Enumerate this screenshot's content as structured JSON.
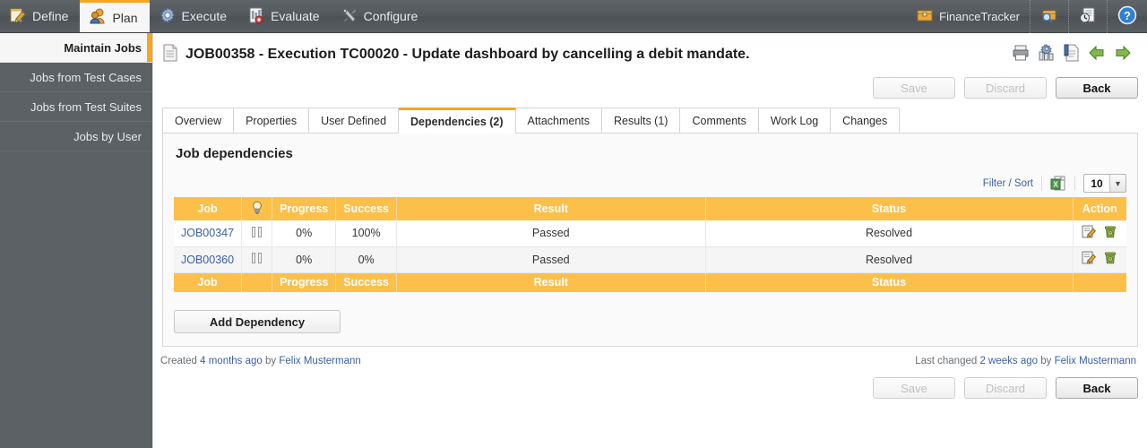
{
  "topnav": {
    "items": [
      {
        "label": "Define",
        "icon": "notepad-pencil-icon",
        "active": false
      },
      {
        "label": "Plan",
        "icon": "people-icon",
        "active": true
      },
      {
        "label": "Execute",
        "icon": "gear-icon",
        "active": false
      },
      {
        "label": "Evaluate",
        "icon": "report-chart-icon",
        "active": false
      },
      {
        "label": "Configure",
        "icon": "tools-icon",
        "active": false
      }
    ],
    "right": {
      "project_label": "FinanceTracker",
      "project_icon": "box-icon",
      "search_icon": "box-search-icon",
      "history_icon": "recent-items-icon",
      "help_icon": "help-icon"
    }
  },
  "sidebar": {
    "items": [
      {
        "label": "Maintain Jobs",
        "active": true
      },
      {
        "label": "Jobs from Test Cases",
        "active": false
      },
      {
        "label": "Jobs from Test Suites",
        "active": false
      },
      {
        "label": "Jobs by User",
        "active": false
      }
    ]
  },
  "header": {
    "icon": "document-icon",
    "title": "JOB00358 - Execution TC00020 - Update dashboard by cancelling a debit mandate.",
    "tools": [
      {
        "name": "print-icon"
      },
      {
        "name": "statistics-icon"
      },
      {
        "name": "report-icon"
      },
      {
        "name": "previous-arrow-icon"
      },
      {
        "name": "next-arrow-icon"
      }
    ]
  },
  "actions": {
    "save_label": "Save",
    "discard_label": "Discard",
    "back_label": "Back"
  },
  "tabs": [
    {
      "label": "Overview",
      "active": false
    },
    {
      "label": "Properties",
      "active": false
    },
    {
      "label": "User Defined",
      "active": false
    },
    {
      "label": "Dependencies (2)",
      "active": true
    },
    {
      "label": "Attachments",
      "active": false
    },
    {
      "label": "Results (1)",
      "active": false
    },
    {
      "label": "Comments",
      "active": false
    },
    {
      "label": "Work Log",
      "active": false
    },
    {
      "label": "Changes",
      "active": false
    }
  ],
  "panel": {
    "title": "Job dependencies",
    "tools": {
      "filter_sort_label": "Filter / Sort",
      "export_icon": "excel-export-icon",
      "page_size": "10"
    },
    "table": {
      "columns": [
        {
          "key": "job",
          "label": "Job"
        },
        {
          "key": "flag",
          "label": "",
          "icon": "lightbulb-icon"
        },
        {
          "key": "progress",
          "label": "Progress"
        },
        {
          "key": "success",
          "label": "Success"
        },
        {
          "key": "result",
          "label": "Result"
        },
        {
          "key": "status",
          "label": "Status"
        },
        {
          "key": "action",
          "label": "Action"
        }
      ],
      "footer_columns": [
        {
          "key": "job",
          "label": "Job"
        },
        {
          "key": "flag",
          "label": ""
        },
        {
          "key": "progress",
          "label": "Progress"
        },
        {
          "key": "success",
          "label": "Success"
        },
        {
          "key": "result",
          "label": "Result"
        },
        {
          "key": "status",
          "label": "Status"
        },
        {
          "key": "action",
          "label": ""
        }
      ],
      "rows": [
        {
          "job": "JOB00347",
          "flag_icon": "pause-icon",
          "progress": "0%",
          "success": "100%",
          "result": "Passed",
          "status": "Resolved",
          "edit_icon": "edit-icon",
          "delete_icon": "delete-icon"
        },
        {
          "job": "JOB00360",
          "flag_icon": "pause-icon",
          "progress": "0%",
          "success": "0%",
          "result": "Passed",
          "status": "Resolved",
          "edit_icon": "edit-icon",
          "delete_icon": "delete-icon"
        }
      ]
    },
    "add_button_label": "Add Dependency"
  },
  "meta": {
    "created_prefix": "Created",
    "created_when": "4 months ago",
    "created_by_label": "by",
    "created_by": "Felix Mustermann",
    "changed_prefix": "Last changed",
    "changed_when": "2 weeks ago",
    "changed_by_label": "by",
    "changed_by": "Felix Mustermann"
  },
  "colors": {
    "accent": "#f5a623",
    "table_header": "#fcbf49",
    "link": "#3b5ea8",
    "chrome": "#5c6165"
  }
}
